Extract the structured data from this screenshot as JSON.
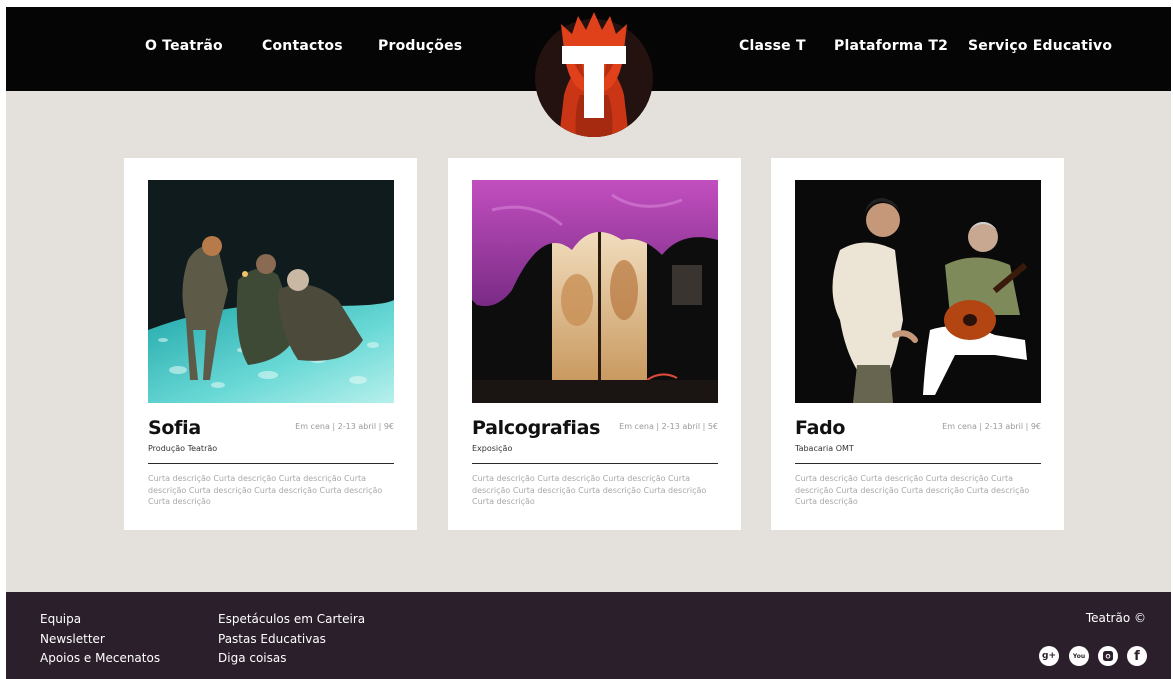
{
  "nav": {
    "left": [
      "O Teatrão",
      "Contactos",
      "Produções"
    ],
    "right": [
      "Classe T",
      "Plataforma T2",
      "Serviço Educativo"
    ]
  },
  "logo": {
    "letter": "T"
  },
  "cards": [
    {
      "title": "Sofia",
      "meta": "Em cena | 2-13 abril | 9€",
      "subtitle": "Produção Teatrão",
      "description": "Curta descrição Curta descrição Curta descrição Curta descrição Curta descrição Curta descrição Curta descrição Curta descrição"
    },
    {
      "title": "Palcografias",
      "meta": "Em cena | 2-13 abril | 5€",
      "subtitle": "Exposição",
      "description": "Curta descrição Curta descrição Curta descrição Curta descrição Curta descrição Curta descrição Curta descrição Curta descrição"
    },
    {
      "title": "Fado",
      "meta": "Em cena | 2-13 abril | 9€",
      "subtitle": "Tabacaria OMT",
      "description": "Curta descrição Curta descrição Curta descrição Curta descrição Curta descrição Curta descrição Curta descrição Curta descrição"
    }
  ],
  "footer": {
    "col1": [
      "Equipa",
      "Newsletter",
      "Apoios e Mecenatos"
    ],
    "col2": [
      "Espetáculos em Carteira",
      "Pastas Educativas",
      "Diga coisas"
    ],
    "copyright": "Teatrão ©",
    "social": [
      {
        "icon": "google-plus-icon",
        "glyph": "g+"
      },
      {
        "icon": "youtube-icon",
        "glyph": "You"
      },
      {
        "icon": "instagram-icon",
        "glyph": ""
      },
      {
        "icon": "facebook-icon",
        "glyph": "f"
      }
    ]
  },
  "colors": {
    "header_bg": "#050505",
    "page_bg": "#e4e1dc",
    "footer_bg": "#2b1f2b",
    "logo_accent": "#e0401a"
  }
}
